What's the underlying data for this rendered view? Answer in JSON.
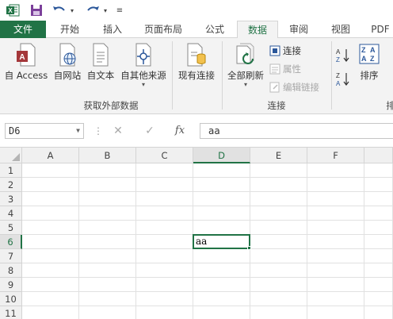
{
  "ribbon": {
    "tabs": [
      {
        "key": "file",
        "label": "文件"
      },
      {
        "key": "home",
        "label": "开始"
      },
      {
        "key": "insert",
        "label": "插入"
      },
      {
        "key": "layout",
        "label": "页面布局"
      },
      {
        "key": "formulas",
        "label": "公式"
      },
      {
        "key": "data",
        "label": "数据"
      },
      {
        "key": "review",
        "label": "审阅"
      },
      {
        "key": "view",
        "label": "视图"
      },
      {
        "key": "pdf",
        "label": "PDF"
      }
    ],
    "active_tab": "数据",
    "get_external": {
      "access": "自 Access",
      "web": "自网站",
      "text": "自文本",
      "other": "自其他来源",
      "existing": "现有连接",
      "label": "获取外部数据"
    },
    "connections": {
      "refresh_all": "全部刷新",
      "connections": "连接",
      "properties": "属性",
      "edit_links": "编辑链接",
      "label": "连接"
    },
    "sort": {
      "sort": "排序",
      "partial_label": "排"
    }
  },
  "formula_bar": {
    "name_box": "D6",
    "fx": "fx",
    "value": "aa"
  },
  "sheet": {
    "columns": [
      "A",
      "B",
      "C",
      "D",
      "E",
      "F"
    ],
    "rows": [
      "1",
      "2",
      "3",
      "4",
      "5",
      "6",
      "7",
      "8",
      "9",
      "10",
      "11"
    ],
    "selected_column": "D",
    "selected_row": "6",
    "cells": {
      "D6": "aa"
    }
  },
  "colors": {
    "accent": "#217346"
  }
}
